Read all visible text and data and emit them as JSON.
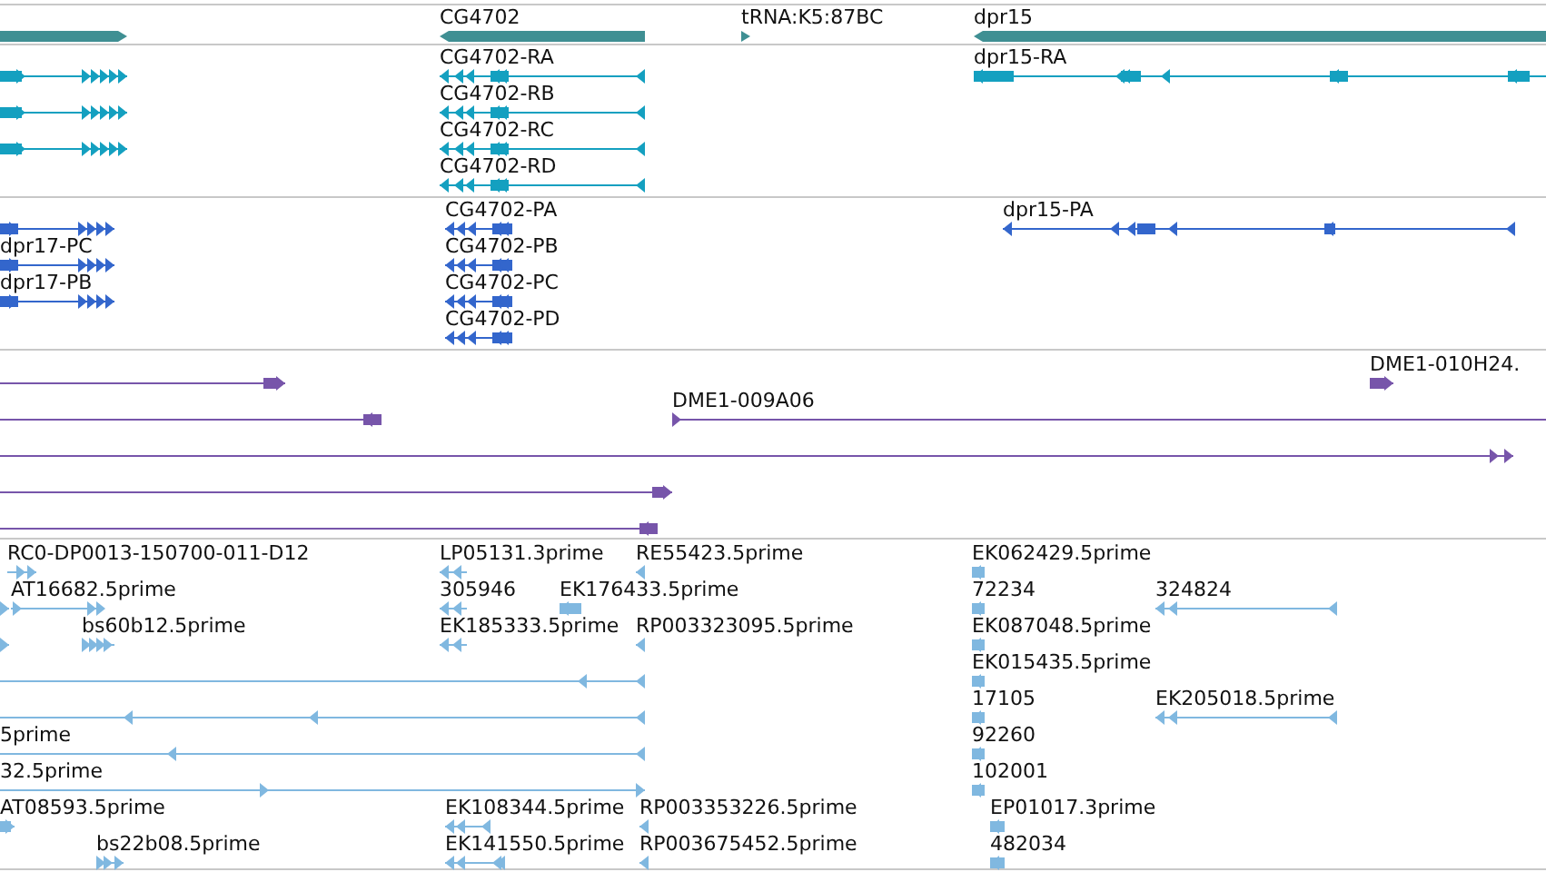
{
  "tracks": [
    {
      "kind": "gene",
      "features": [
        {
          "reverse": false
        },
        {
          "label": "CG4702",
          "reverse": true
        },
        {
          "label": "tRNA:K5:87BC",
          "reverse": false
        },
        {
          "label": "dpr15",
          "reverse": true
        }
      ]
    },
    {
      "kind": "transcript",
      "features": [
        {
          "reverse": false
        },
        {
          "reverse": false
        },
        {
          "reverse": false
        },
        {
          "label": "CG4702-RA",
          "reverse": true
        },
        {
          "label": "CG4702-RB",
          "reverse": true
        },
        {
          "label": "CG4702-RC",
          "reverse": true
        },
        {
          "label": "CG4702-RD",
          "reverse": true
        },
        {
          "label": "dpr15-RA",
          "reverse": true
        }
      ]
    },
    {
      "kind": "protein",
      "features": [
        {
          "reverse": false
        },
        {
          "label": "dpr17-PC",
          "reverse": false
        },
        {
          "label": "dpr17-PB",
          "reverse": false
        },
        {
          "label": "CG4702-PA",
          "reverse": true
        },
        {
          "label": "CG4702-PB",
          "reverse": true
        },
        {
          "label": "CG4702-PC",
          "reverse": true
        },
        {
          "label": "CG4702-PD",
          "reverse": true
        },
        {
          "label": "dpr15-PA",
          "reverse": true
        }
      ]
    },
    {
      "kind": "clone",
      "features": [
        {
          "reverse": false
        },
        {
          "label": "DME1-010H24.",
          "reverse": false
        },
        {
          "reverse": true
        },
        {
          "label": "DME1-009A06",
          "reverse": false
        },
        {
          "reverse": false
        },
        {
          "reverse": false
        },
        {
          "reverse": true
        }
      ]
    },
    {
      "kind": "est",
      "features": [
        {
          "label": "RC0-DP0013-150700-011-D12",
          "reverse": false
        },
        {
          "label": "LP05131.3prime",
          "reverse": true
        },
        {
          "label": "RE55423.5prime",
          "reverse": true
        },
        {
          "label": "EK062429.5prime",
          "reverse": true
        },
        {
          "reverse": false
        },
        {
          "label": "AT16682.5prime",
          "reverse": false
        },
        {
          "label": "305946",
          "reverse": true
        },
        {
          "label": "EK176433.5prime",
          "reverse": true
        },
        {
          "label": "72234",
          "reverse": true
        },
        {
          "label": "324824",
          "reverse": true
        },
        {
          "reverse": false
        },
        {
          "label": "bs60b12.5prime",
          "reverse": false
        },
        {
          "label": "EK185333.5prime",
          "reverse": true
        },
        {
          "label": "RP003323095.5prime",
          "reverse": true
        },
        {
          "label": "EK087048.5prime",
          "reverse": true
        },
        {
          "reverse": true
        },
        {
          "label": "EK015435.5prime",
          "reverse": true
        },
        {
          "reverse": true
        },
        {
          "label": "17105",
          "reverse": true
        },
        {
          "label": "EK205018.5prime",
          "reverse": true
        },
        {
          "label": "5prime",
          "reverse": true
        },
        {
          "label": "92260",
          "reverse": true
        },
        {
          "label": "32.5prime",
          "reverse": false
        },
        {
          "label": "102001",
          "reverse": true
        },
        {
          "label": "AT08593.5prime",
          "reverse": false
        },
        {
          "label": "EK108344.5prime",
          "reverse": true
        },
        {
          "label": "RP003353226.5prime",
          "reverse": true
        },
        {
          "label": "EP01017.3prime",
          "reverse": true
        },
        {
          "label": "bs22b08.5prime",
          "reverse": false
        },
        {
          "label": "EK141550.5prime",
          "reverse": true
        },
        {
          "label": "RP003675452.5prime",
          "reverse": true
        },
        {
          "label": "482034",
          "reverse": true
        }
      ]
    }
  ]
}
